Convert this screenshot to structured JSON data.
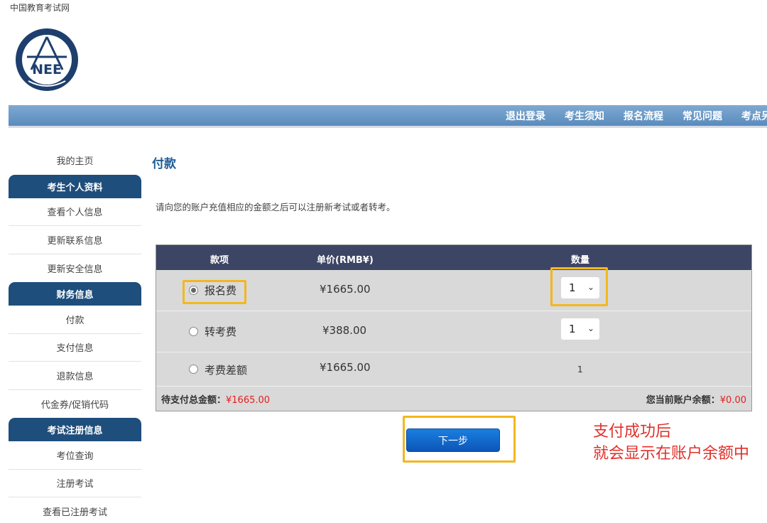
{
  "site_name": "中国教育考试网",
  "logo": {
    "text": "NEE"
  },
  "nav": [
    "退出登录",
    "考生须知",
    "报名流程",
    "常见问题",
    "考点另"
  ],
  "sidebar": {
    "home": "我的主页",
    "sections": [
      {
        "title": "考生个人资料",
        "items": [
          "查看个人信息",
          "更新联系信息",
          "更新安全信息"
        ]
      },
      {
        "title": "财务信息",
        "items": [
          "付款",
          "支付信息",
          "退款信息",
          "代金券/促销代码"
        ]
      },
      {
        "title": "考试注册信息",
        "items": [
          "考位查询",
          "注册考试",
          "查看已注册考试"
        ]
      }
    ]
  },
  "main": {
    "title": "付款",
    "instruction": "请向您的账户充值相应的金额之后可以注册新考试或者转考。",
    "table": {
      "headers": {
        "item": "款项",
        "price": "单价(RMB¥)",
        "qty": "数量"
      },
      "rows": [
        {
          "name": "报名费",
          "price": "¥1665.00",
          "qty": "1",
          "checked": true
        },
        {
          "name": "转考费",
          "price": "¥388.00",
          "qty": "1",
          "checked": false
        },
        {
          "name": "考费差额",
          "price": "¥1665.00",
          "qty": "1",
          "checked": false
        }
      ],
      "total_label": "待支付总金额：",
      "total_value": "¥1665.00",
      "balance_label": "您当前账户余额：",
      "balance_value": "¥0.00"
    },
    "next_button": "下一步"
  },
  "annotation": {
    "line1": "支付成功后",
    "line2": "就会显示在账户余额中"
  },
  "colors": {
    "nav_bar": "#6a98c6",
    "sidebar_head": "#1e4e7c",
    "table_head": "#3d4565",
    "highlight": "#f3b71e",
    "annotation": "#e0302a",
    "button": "#1466cc"
  }
}
